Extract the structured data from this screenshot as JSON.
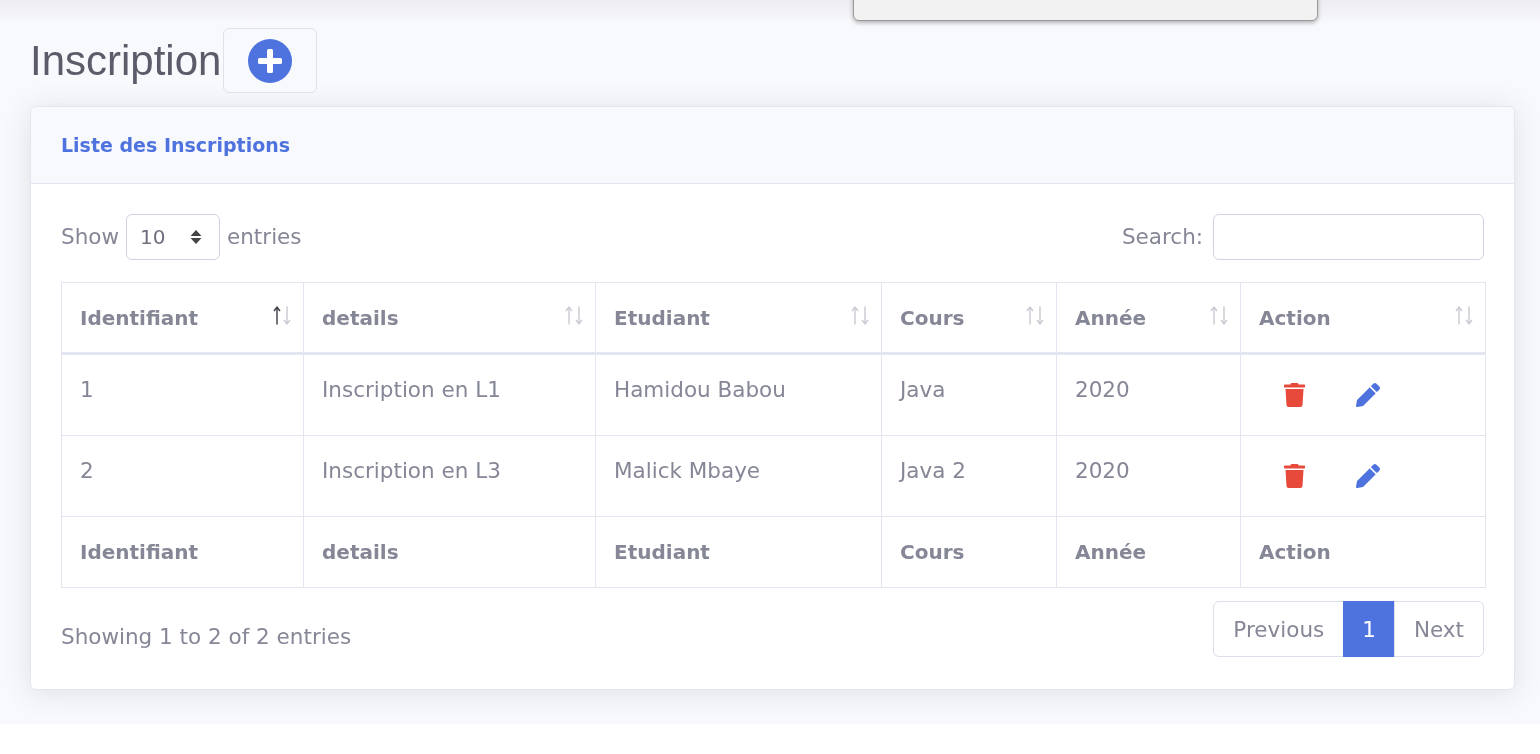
{
  "page_title": "Inscription",
  "card": {
    "title": "Liste des Inscriptions",
    "length_control": {
      "label_before": "Show",
      "value": "10",
      "label_after": "entries"
    },
    "search": {
      "label": "Search:"
    },
    "table": {
      "columns": [
        {
          "label": "Identifiant",
          "sorted": true,
          "kind": "text"
        },
        {
          "label": "details",
          "sorted": false,
          "kind": "text"
        },
        {
          "label": "Etudiant",
          "sorted": false,
          "kind": "text"
        },
        {
          "label": "Cours",
          "sorted": false,
          "kind": "text"
        },
        {
          "label": "Année",
          "sorted": false,
          "kind": "text"
        },
        {
          "label": "Action",
          "sorted": false,
          "kind": "actions"
        }
      ],
      "rows": [
        {
          "cells": [
            "1",
            "Inscription en L1",
            "Hamidou Babou",
            "Java",
            "2020"
          ]
        },
        {
          "cells": [
            "2",
            "Inscription en L3",
            "Malick Mbaye",
            "Java 2",
            "2020"
          ]
        }
      ],
      "footer": [
        "Identifiant",
        "details",
        "Etudiant",
        "Cours",
        "Année",
        "Action"
      ]
    },
    "info": "Showing 1 to 2 of 2 entries",
    "pagination": {
      "previous": {
        "label": "Previous",
        "disabled": true
      },
      "pages": [
        {
          "label": "1",
          "selected": true
        }
      ],
      "next": {
        "label": "Next",
        "disabled": true
      }
    }
  }
}
